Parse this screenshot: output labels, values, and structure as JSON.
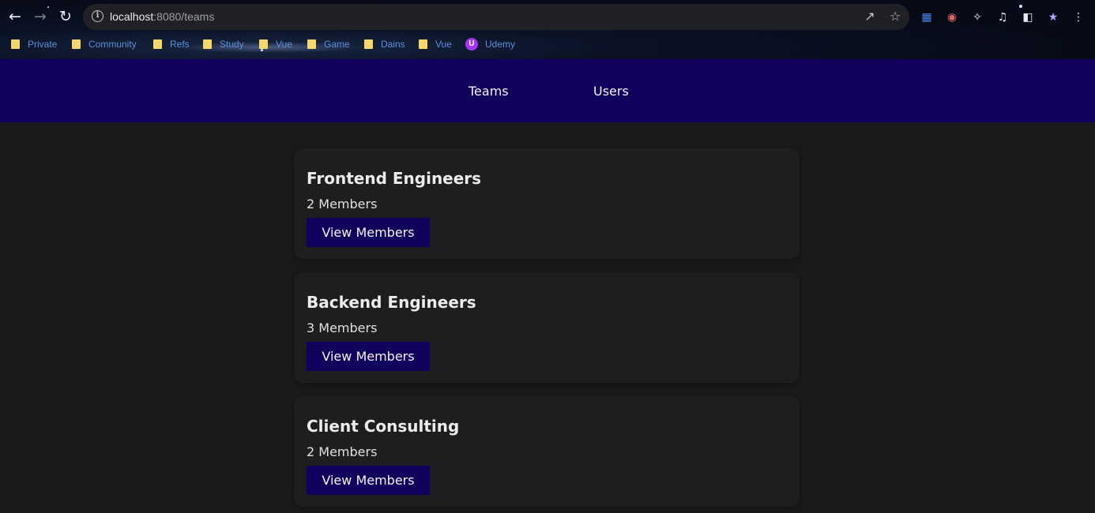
{
  "browser": {
    "url_host": "localhost",
    "url_path": ":8080/teams",
    "nav": {
      "back_icon": "arrow-left-icon",
      "forward_icon": "arrow-right-icon",
      "reload_icon": "reload-icon"
    },
    "bookmarks": [
      {
        "label": "Private",
        "icon": "folder-icon"
      },
      {
        "label": "Community",
        "icon": "folder-icon"
      },
      {
        "label": "Refs",
        "icon": "folder-icon"
      },
      {
        "label": "Study",
        "icon": "folder-icon"
      },
      {
        "label": "Vue",
        "icon": "folder-icon"
      },
      {
        "label": "Game",
        "icon": "folder-icon"
      },
      {
        "label": "Dains",
        "icon": "folder-icon"
      },
      {
        "label": "Vue",
        "icon": "folder-icon"
      },
      {
        "label": "Udemy",
        "icon": "udemy-icon"
      }
    ]
  },
  "header": {
    "links": [
      {
        "label": "Teams"
      },
      {
        "label": "Users"
      }
    ]
  },
  "teams": [
    {
      "name": "Frontend Engineers",
      "members": "2 Members",
      "button": "View Members"
    },
    {
      "name": "Backend Engineers",
      "members": "3 Members",
      "button": "View Members"
    },
    {
      "name": "Client Consulting",
      "members": "2 Members",
      "button": "View Members"
    }
  ],
  "colors": {
    "header_bg": "#11005c",
    "page_bg": "#1a1a1b",
    "card_bg": "#1d1e20",
    "button_bg": "#11005c"
  }
}
